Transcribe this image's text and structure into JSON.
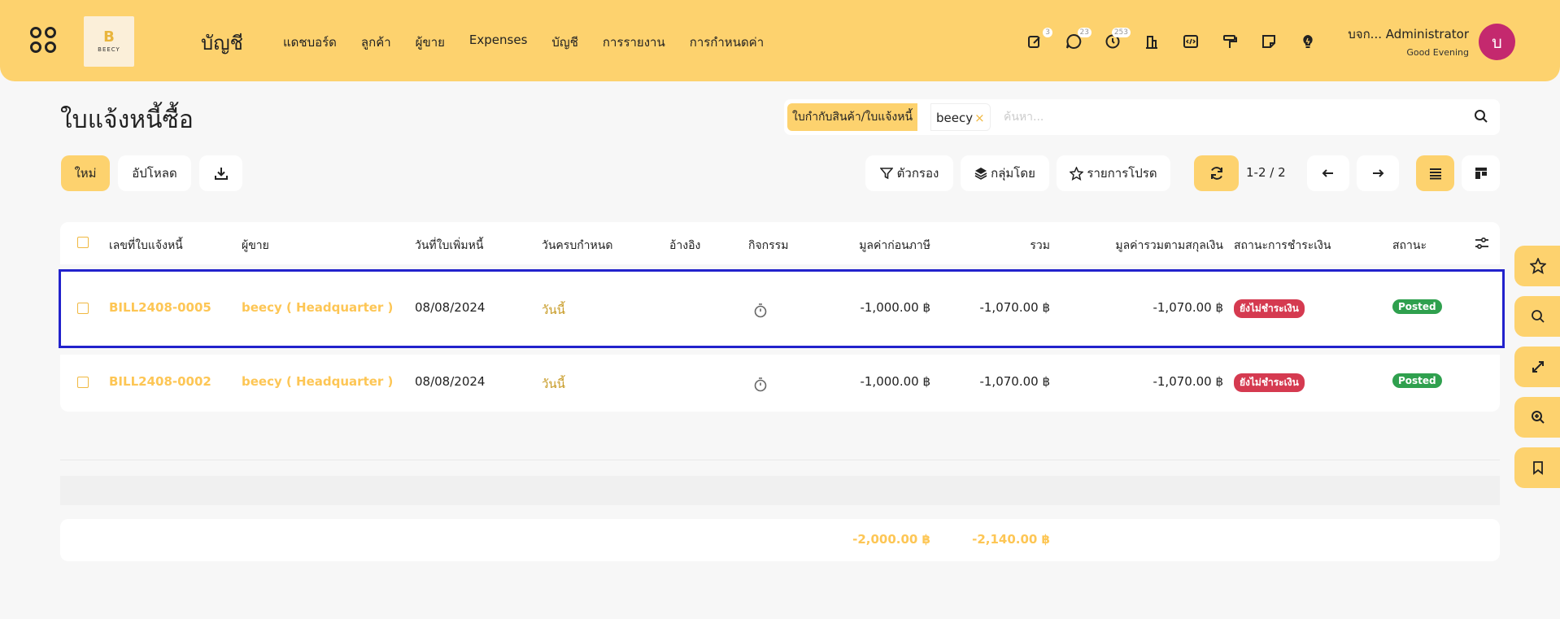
{
  "topbar": {
    "logo_letter": "B",
    "logo_text": "BEECY",
    "app_title": "บัญชี",
    "menu": [
      "แดชบอร์ด",
      "ลูกค้า",
      "ผู้ขาย",
      "Expenses",
      "บัญชี",
      "การรายงาน",
      "การกำหนดค่า"
    ],
    "badges": {
      "activity": "3",
      "messages": "23",
      "clock": "253"
    },
    "user_name": "บจก... Administrator",
    "greeting": "Good Evening",
    "avatar_letter": "บ",
    "accent": "#fdd26e",
    "avatar_color": "#c4296e"
  },
  "page": {
    "title": "ใบแจ้งหนี้ซื้อ",
    "search": {
      "facet_label": "ใบกำกับสินค้า/ใบแจ้งหนี้",
      "facet_value": "beecy",
      "facet_remove": "×",
      "placeholder": "ค้นหา..."
    },
    "buttons": {
      "new": "ใหม่",
      "upload": "อัปโหลด",
      "filter": "ตัวกรอง",
      "group_by": "กลุ่มโดย",
      "favorites": "รายการโปรด"
    },
    "pager": "1-2 / 2"
  },
  "table": {
    "headers": [
      "เลขที่ใบแจ้งหนี้",
      "ผู้ขาย",
      "วันที่ใบเพิ่มหนี้",
      "วันครบกำหนด",
      "อ้างอิง",
      "กิจกรรม",
      "มูลค่าก่อนภาษี",
      "รวม",
      "มูลค่ารวมตามสกุลเงิน",
      "สถานะการชำระเงิน",
      "สถานะ"
    ],
    "rows": [
      {
        "number": "BILL2408-0005",
        "vendor": "beecy ( Headquarter )",
        "date": "08/08/2024",
        "due": "วันนี้",
        "ref": "",
        "untaxed": "-1,000.00 ฿",
        "total": "-1,070.00 ฿",
        "total_currency": "-1,070.00 ฿",
        "payment_status": "ยังไม่ชำระเงิน",
        "status": "Posted"
      },
      {
        "number": "BILL2408-0002",
        "vendor": "beecy ( Headquarter )",
        "date": "08/08/2024",
        "due": "วันนี้",
        "ref": "",
        "untaxed": "-1,000.00 ฿",
        "total": "-1,070.00 ฿",
        "total_currency": "-1,070.00 ฿",
        "payment_status": "ยังไม่ชำระเงิน",
        "status": "Posted"
      }
    ],
    "footer": {
      "untaxed": "-2,000.00 ฿",
      "total": "-2,140.00 ฿"
    }
  },
  "icons": {
    "apps": "apps-icon",
    "activity": "edit-note-icon",
    "messages": "chat-bubble-icon",
    "clock": "clock-icon",
    "building": "building-icon",
    "code": "code-icon",
    "paint": "paint-roller-icon",
    "note": "sticky-note-icon",
    "tips": "lightbulb-icon",
    "download": "download-icon",
    "refresh": "refresh-icon",
    "prev": "arrow-left-icon",
    "next": "arrow-right-icon",
    "list_view": "list-view-icon",
    "kanban_view": "kanban-view-icon",
    "optional_columns": "sliders-icon",
    "activity_clock": "stopwatch-icon",
    "float": [
      "star-icon",
      "search-icon",
      "expand-icon",
      "zoom-in-icon",
      "bookmark-icon"
    ]
  },
  "colors": {
    "link": "#fdc655",
    "due": "#c79a24",
    "payment_unpaid": "#d53a50",
    "posted": "#2fa04e",
    "selection": "#2222cc"
  }
}
